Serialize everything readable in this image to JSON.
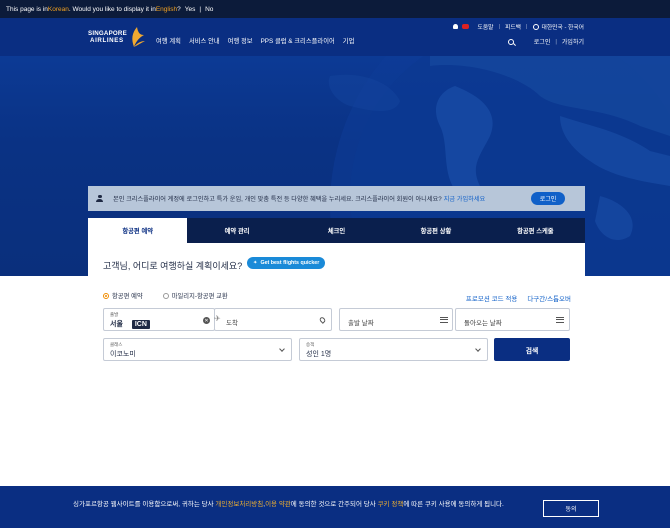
{
  "translate_bar": {
    "prefix": "This page is in ",
    "source_lang": "Korean",
    "middle": ". Would you like to display it in ",
    "target_lang": "English",
    "suffix": "?",
    "yes": "Yes",
    "no": "No"
  },
  "header": {
    "logo_line1": "SINGAPORE",
    "logo_line2": "AIRLINES",
    "nav": [
      "여행 계획",
      "서비스 안내",
      "여행 정보",
      "PPS 클럽 & 크리스플라이어",
      "기업"
    ],
    "util_top": {
      "help": "도움말",
      "feedback": "피드백",
      "region": "대한민국 - 한국어"
    },
    "util_bottom": {
      "login": "로그인",
      "signup": "가입하기"
    }
  },
  "login_banner": {
    "text": "본인 크리스플라이어 계정에 로그인하고 특가 운임, 개인 맞춤 특전 등 다양한 혜택을 누리세요. 크리스플라이어 회원이 아니세요?",
    "link": "지금 가입하세요",
    "button": "로그인"
  },
  "tabs": [
    "항공편 예약",
    "예약 관리",
    "체크인",
    "항공편 상황",
    "항공편 스케줄"
  ],
  "booking": {
    "question": "고객님, 어디로 여행하실 계획이세요?",
    "quick_pill": "Get best flights quicker",
    "radio_options": [
      "항공편 예약",
      "마일리지-항공편 교환"
    ],
    "right_links": [
      "프로모션 코드 적용",
      "다구간/스톱오버"
    ],
    "from": {
      "mini_label": "출발",
      "city": "서울",
      "code": "ICN"
    },
    "to_placeholder": "도착",
    "depart_placeholder": "출발 날짜",
    "return_placeholder": "돌아오는 날짜",
    "cabin": {
      "mini_label": "클래스",
      "value": "이코노미"
    },
    "passengers": {
      "mini_label": "승객",
      "value": "성인 1명"
    },
    "search_button": "검색"
  },
  "cookie": {
    "part1": "싱가포르항공 웹사이트를 이용함으로써, 귀하는 당사 ",
    "link1": "개인정보처리방침",
    "comma": ",",
    "link2": "이용 약관",
    "part2": "에 동의한 것으로 간주되어 당사 ",
    "link3": "쿠키 정책",
    "part3": "에 따른 쿠키 사용에 동의하게 됩니다.",
    "button": "동의"
  }
}
